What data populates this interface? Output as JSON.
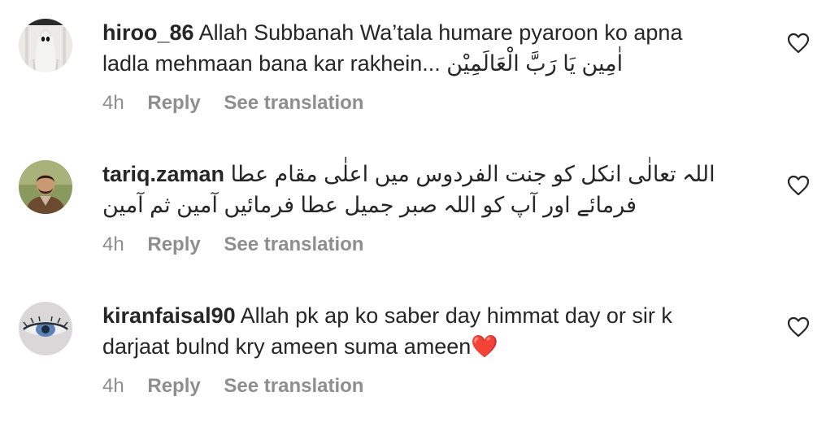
{
  "comments": [
    {
      "username": "hiroo_86",
      "text_line1": "Allah Subbanah Wa’tala humare pyaroon ko apna",
      "text_line2_ltr": "ladla mehmaan bana kar rakhein...",
      "text_line2_rtl": "اٰمِین یَا رَبَّ الْعَالَمِیْن",
      "time": "4h",
      "reply_label": "Reply",
      "translation_label": "See translation",
      "avatar_icon": "ghost-avatar-icon",
      "like_icon": "heart-outline-icon"
    },
    {
      "username": "tariq.zaman",
      "text_line1": "اللہ تعالٰی انکل کو جنت الفردوس میں اعلٰی مقام عطا",
      "text_line2": "فرمائے اور آپ کو اللہ صبر جمیل عطا فرمائیں آمین ثم آمین",
      "time": "4h",
      "reply_label": "Reply",
      "translation_label": "See translation",
      "avatar_icon": "man-portrait-avatar-icon",
      "like_icon": "heart-outline-icon"
    },
    {
      "username": "kiranfaisal90",
      "text_line1": "Allah pk ap ko saber day himmat day or sir k",
      "text_line2": "darjaat bulnd kry ameen suma ameen",
      "emoji": "❤️",
      "time": "4h",
      "reply_label": "Reply",
      "translation_label": "See translation",
      "avatar_icon": "eye-avatar-icon",
      "like_icon": "heart-outline-icon"
    }
  ],
  "colors": {
    "text": "#262626",
    "meta": "#8e8e8e",
    "heart_emoji": "#e0243b"
  }
}
